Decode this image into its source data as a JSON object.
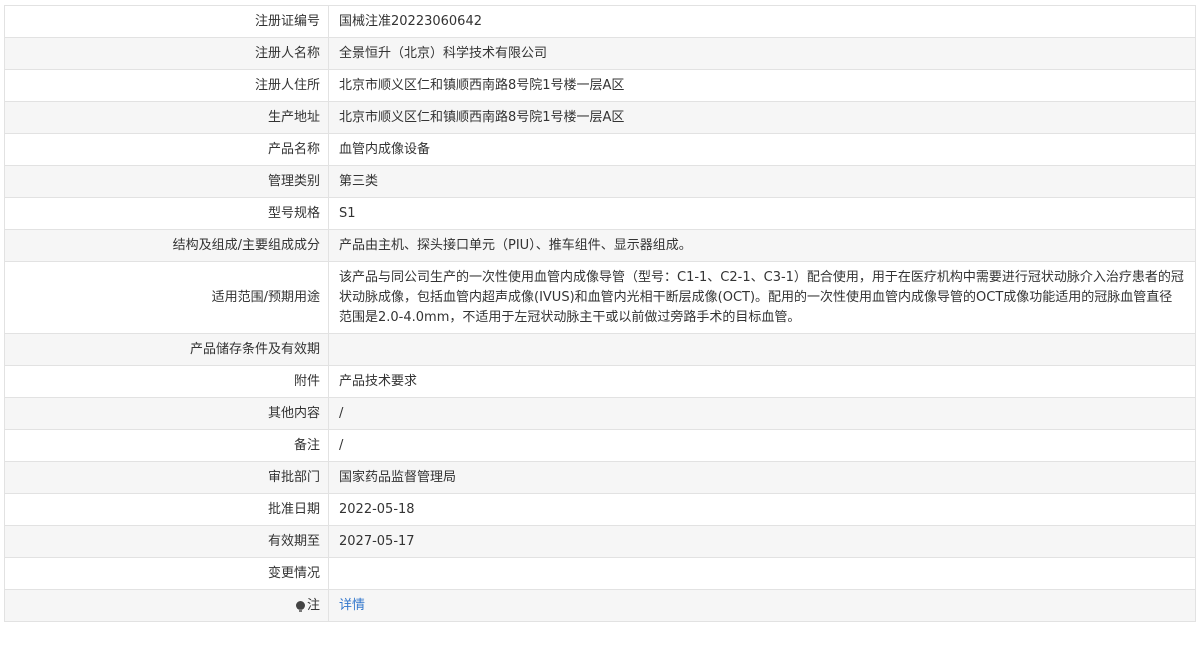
{
  "rows": [
    {
      "label": "注册证编号",
      "value": "国械注准20223060642"
    },
    {
      "label": "注册人名称",
      "value": "全景恒升（北京）科学技术有限公司"
    },
    {
      "label": "注册人住所",
      "value": "北京市顺义区仁和镇顺西南路8号院1号楼一层A区"
    },
    {
      "label": "生产地址",
      "value": "北京市顺义区仁和镇顺西南路8号院1号楼一层A区"
    },
    {
      "label": "产品名称",
      "value": "血管内成像设备"
    },
    {
      "label": "管理类别",
      "value": "第三类"
    },
    {
      "label": "型号规格",
      "value": "S1"
    },
    {
      "label": "结构及组成/主要组成成分",
      "value": "产品由主机、探头接口单元（PIU）、推车组件、显示器组成。"
    },
    {
      "label": "适用范围/预期用途",
      "value": "该产品与同公司生产的一次性使用血管内成像导管（型号：C1-1、C2-1、C3-1）配合使用，用于在医疗机构中需要进行冠状动脉介入治疗患者的冠状动脉成像，包括血管内超声成像(IVUS)和血管内光相干断层成像(OCT)。配用的一次性使用血管内成像导管的OCT成像功能适用的冠脉血管直径范围是2.0-4.0mm，不适用于左冠状动脉主干或以前做过旁路手术的目标血管。"
    },
    {
      "label": "产品储存条件及有效期",
      "value": ""
    },
    {
      "label": "附件",
      "value": "产品技术要求"
    },
    {
      "label": "其他内容",
      "value": "/"
    },
    {
      "label": "备注",
      "value": "/"
    },
    {
      "label": "审批部门",
      "value": "国家药品监督管理局"
    },
    {
      "label": "批准日期",
      "value": "2022-05-18"
    },
    {
      "label": "有效期至",
      "value": "2027-05-17"
    },
    {
      "label": "变更情况",
      "value": ""
    },
    {
      "label": "注",
      "value": "详情"
    }
  ],
  "icons": {
    "note": "lightbulb-icon"
  },
  "colors": {
    "link": "#3377cc",
    "alt_row_bg": "#f6f6f6",
    "border": "#e2e2e2"
  }
}
